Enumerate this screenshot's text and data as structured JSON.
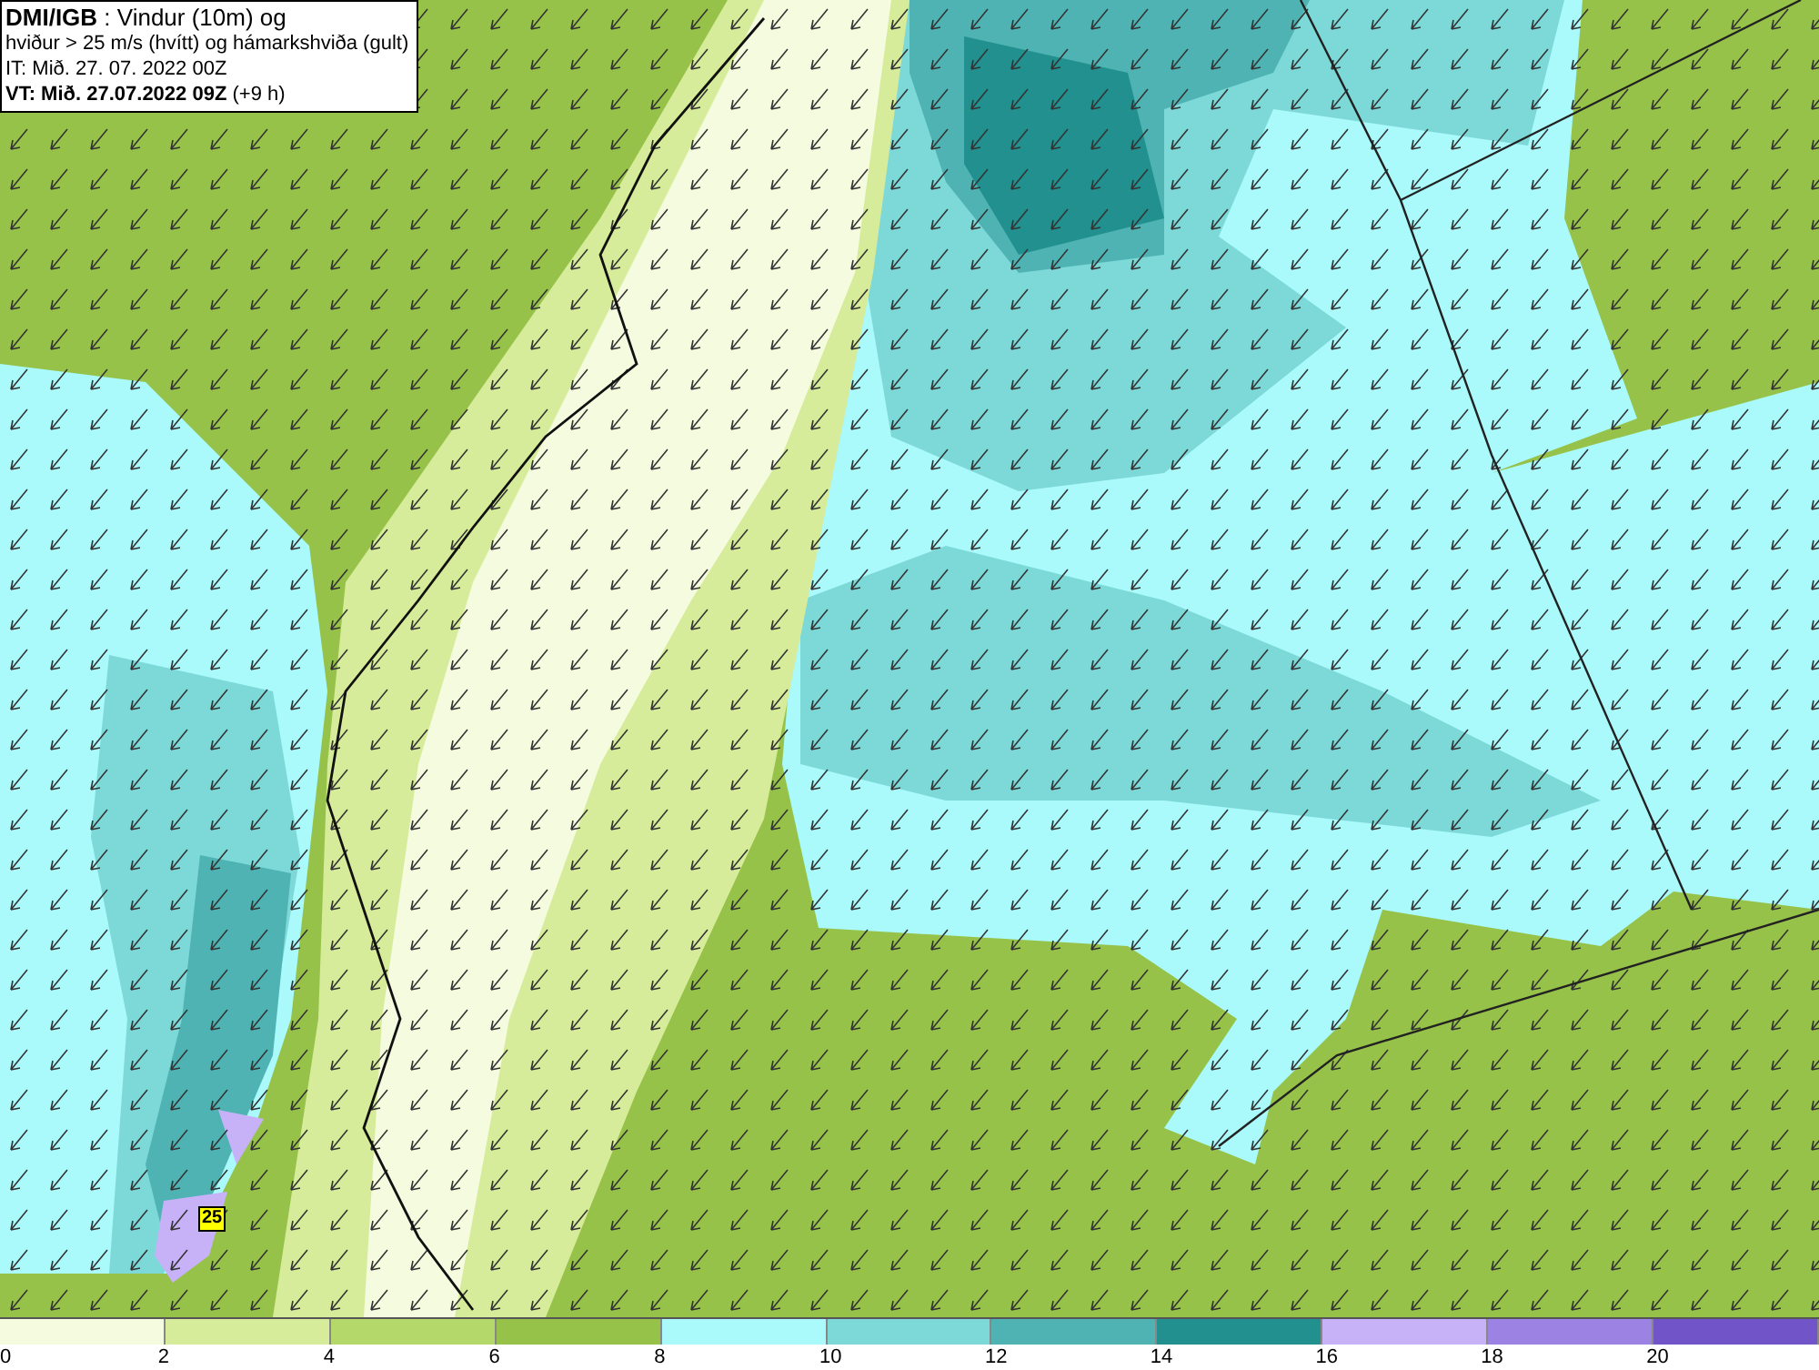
{
  "header": {
    "lines": [
      "**DMI/IGB** : Vindur (10m) og",
      "hviður > 25 m/s (hvítt) og hámarkshviða (gult)",
      "IT: Mið. 27. 07. 2022 00Z",
      "**VT: Mið. 27.07.2022 09Z** (+9 h)"
    ]
  },
  "map": {
    "gust_marker": "25"
  },
  "legend": [
    {
      "label": "0",
      "color": "#f5fbdf"
    },
    {
      "label": "2",
      "color": "#d6ec9a"
    },
    {
      "label": "4",
      "color": "#b5d86a"
    },
    {
      "label": "6",
      "color": "#97c24a"
    },
    {
      "label": "8",
      "color": "#aaf9fb"
    },
    {
      "label": "10",
      "color": "#7dd8d8"
    },
    {
      "label": "12",
      "color": "#4fb3b3"
    },
    {
      "label": "14",
      "color": "#21908f"
    },
    {
      "label": "16",
      "color": "#c7b2f8"
    },
    {
      "label": "18",
      "color": "#9c82e3"
    },
    {
      "label": "20",
      "color": "#7155c8"
    }
  ]
}
